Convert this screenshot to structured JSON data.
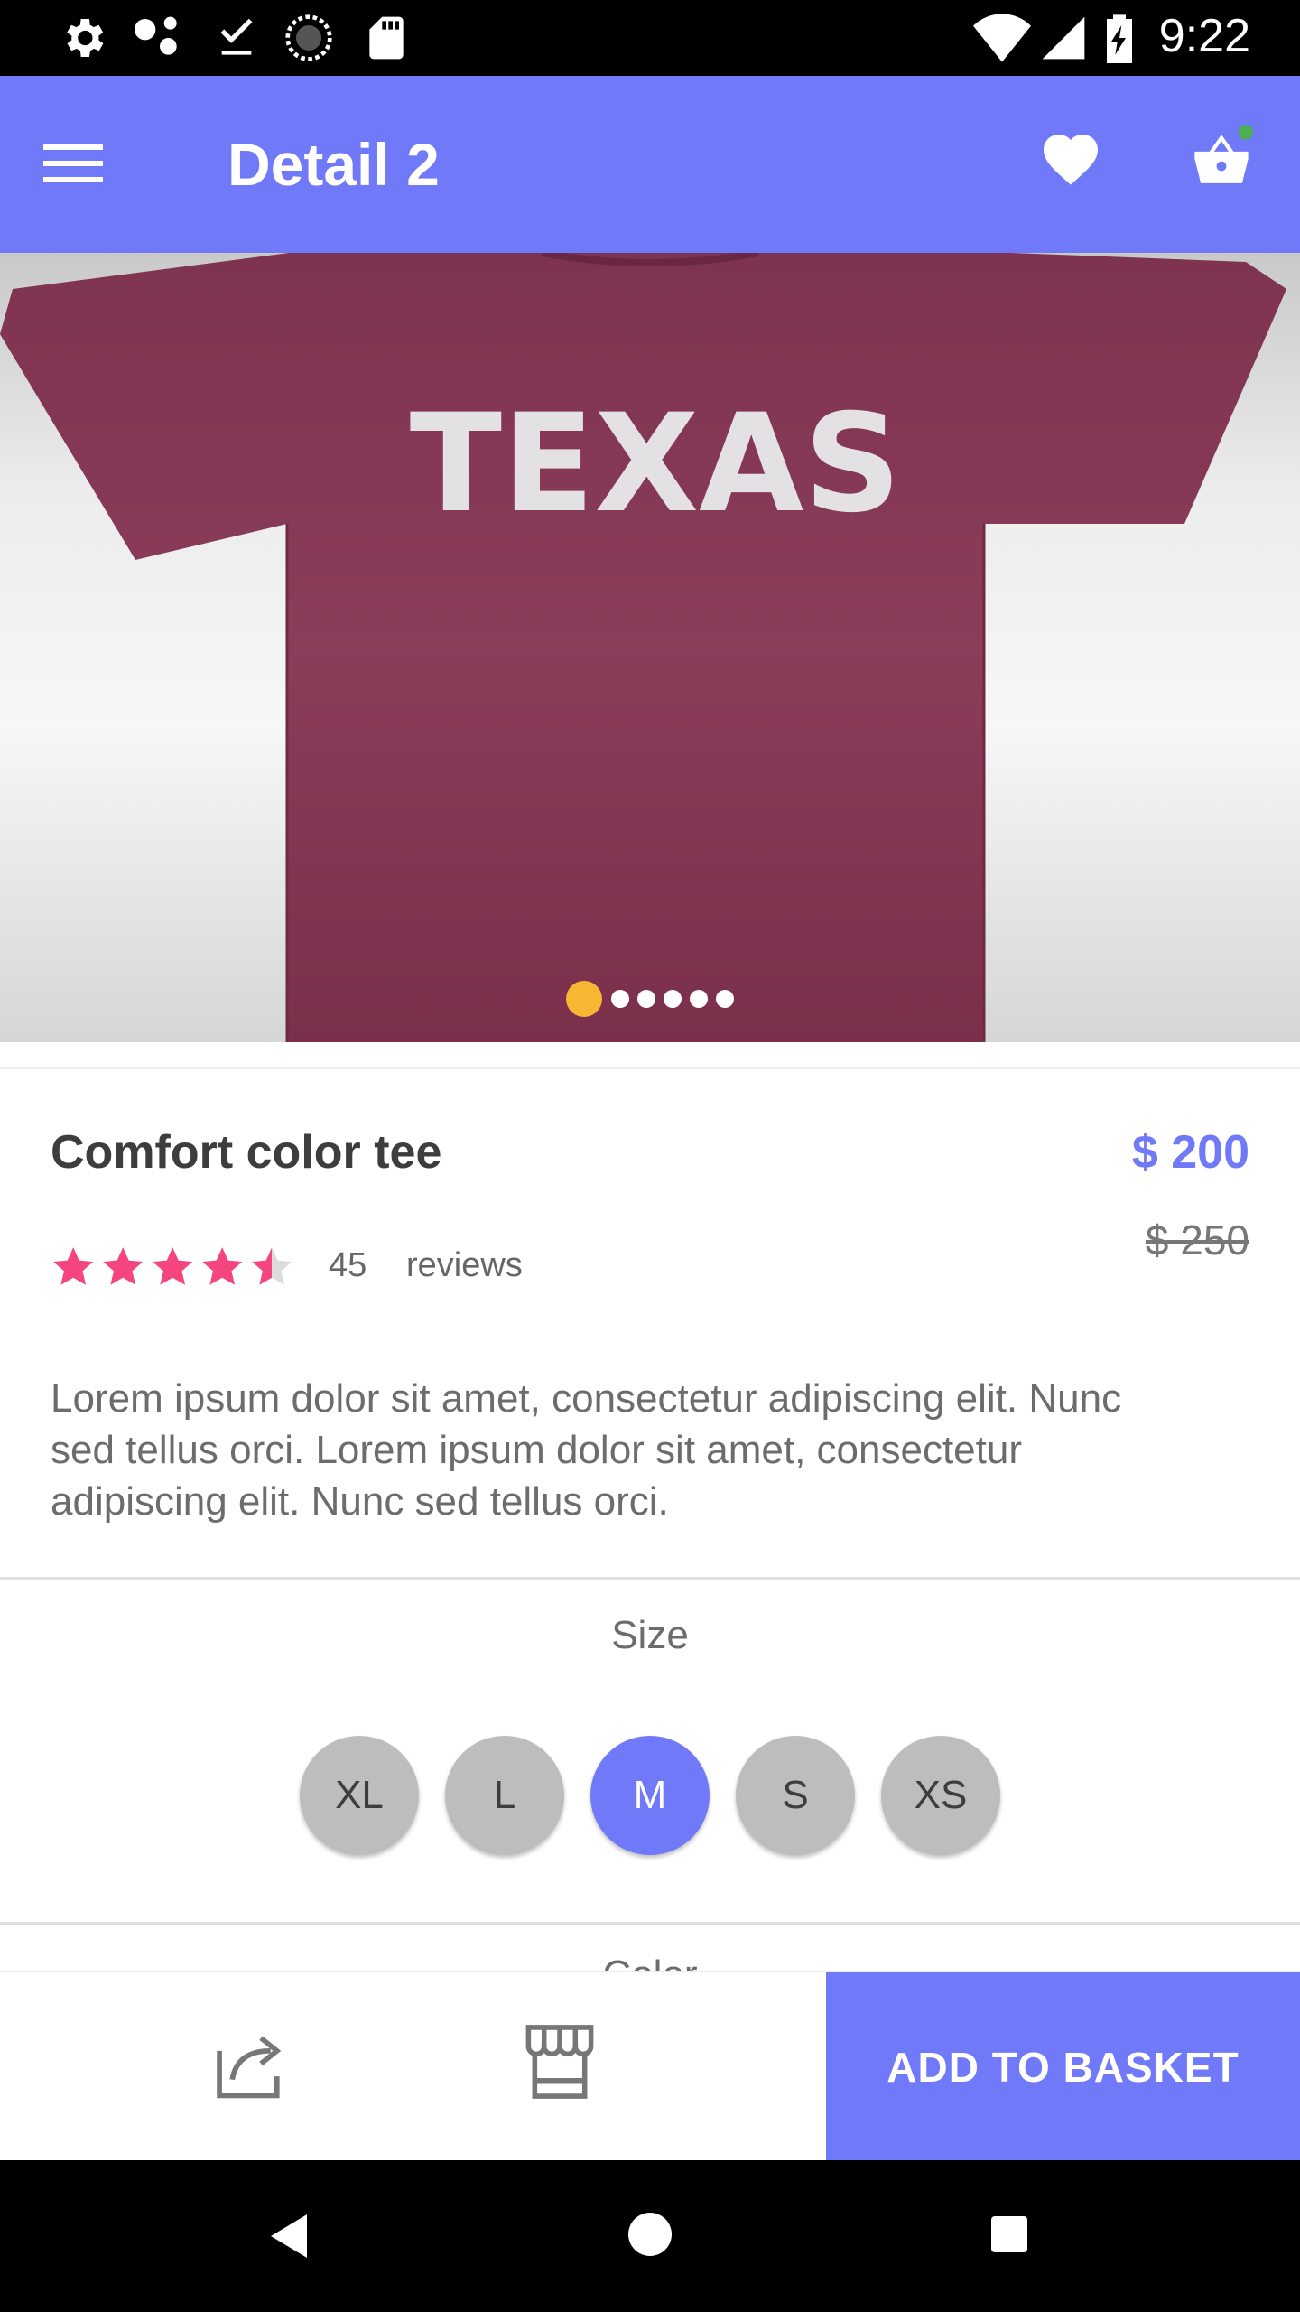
{
  "status_bar": {
    "time": "9:22",
    "icons": [
      "settings-icon",
      "mesh-icon",
      "download-done-icon",
      "sync-circle-icon",
      "sd-card-icon",
      "wifi-icon",
      "signal-icon",
      "battery-charging-icon"
    ]
  },
  "app_bar": {
    "title": "Detail 2",
    "menu_icon": "hamburger-menu-icon",
    "favorite_icon": "heart-icon",
    "cart_icon": "basket-icon",
    "cart_badge_color": "#4caf50",
    "background_color": "#7079f7"
  },
  "hero": {
    "shirt_text": "TEXAS",
    "shirt_color": "#8a3a57",
    "page_count": 6,
    "active_page": 1
  },
  "product": {
    "title": "Comfort color tee",
    "price": "$ 200",
    "old_price": "$ 250",
    "rating": 4.5,
    "rating_max": 5,
    "review_count": "45",
    "review_label": "reviews",
    "description": "Lorem ipsum dolor sit amet, consectetur adipiscing elit. Nunc sed tellus orci. Lorem ipsum dolor sit amet, consectetur adipiscing elit. Nunc sed tellus orci."
  },
  "size": {
    "label": "Size",
    "options": [
      "XL",
      "L",
      "M",
      "S",
      "XS"
    ],
    "selected": "M"
  },
  "color_section": {
    "label": "Color"
  },
  "actions": {
    "share_icon": "share-icon",
    "store_icon": "store-icon",
    "add_label": "ADD TO BASKET"
  },
  "colors": {
    "accent": "#7079f7",
    "star": "#f5457f",
    "pager_active": "#f7b733"
  },
  "nav_bar": {
    "icons": [
      "back-icon",
      "home-icon",
      "recents-icon"
    ]
  }
}
